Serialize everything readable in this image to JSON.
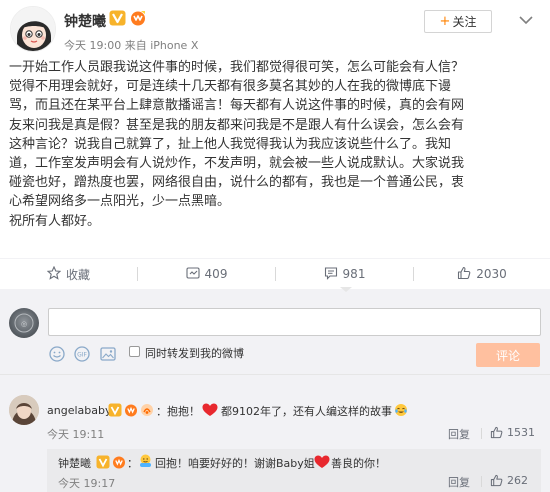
{
  "post": {
    "author": "钟楚曦",
    "meta": "今天 19:00 来自 iPhone X",
    "follow_label": "关注",
    "follow_plus": "+",
    "body_lines": [
      "一开始工作人员跟我说这件事的时候，我们都觉得很可笑，怎么可能会有人信？",
      "觉得不用理会就好，可是连续十几天都有很多莫名其妙的人在我的微博底下谩",
      "骂，而且还在某平台上肆意散播谣言！每天都有人说这件事的时候，真的会有网",
      "友来问我是真是假？甚至是我的朋友都来问我是不是跟人有什么误会，怎么会有",
      "这种言论？说我自己就算了，扯上他人我觉得我认为我应该说些什么了。我知",
      "道，工作室发声明会有人说炒作，不发声明，就会被一些人说成默认。大家说我",
      "碰瓷也好，蹭热度也罢，网络很自由，说什么的都有，我也是一个普通公民，衷",
      "心希望网络多一点阳光，少一点黑暗。",
      "祝所有人都好。"
    ]
  },
  "actions": {
    "favorite_label": "收藏",
    "repost_count": "409",
    "comment_count": "981",
    "like_count": "2030"
  },
  "compose": {
    "also_repost_label": "同时转发到我的微博",
    "submit_label": "评论"
  },
  "comments": [
    {
      "user": "angelababy",
      "text_a": "：抱抱！",
      "text_b": "都9102年了，还有人编这样的故事",
      "time": "今天 19:11",
      "reply_label": "回复",
      "like_count": "1531",
      "reply": {
        "user": "钟楚曦",
        "text_a": "：",
        "text_b": "回抱！咱要好好的！谢谢Baby姐",
        "text_c": "善良的你！",
        "time": "今天 19:17",
        "reply_label": "回复",
        "like_count": "262"
      }
    }
  ],
  "colors": {
    "accent_orange": "#ff8200",
    "heart_red": "#e8282e",
    "v_badge": "#f7b32b",
    "submit_disabled": "#ffc09f"
  },
  "icons": {
    "more": "chevron-down-icon",
    "favorite": "star-icon",
    "repost": "repost-icon",
    "comment": "comment-icon",
    "like": "thumbs-up-icon"
  }
}
